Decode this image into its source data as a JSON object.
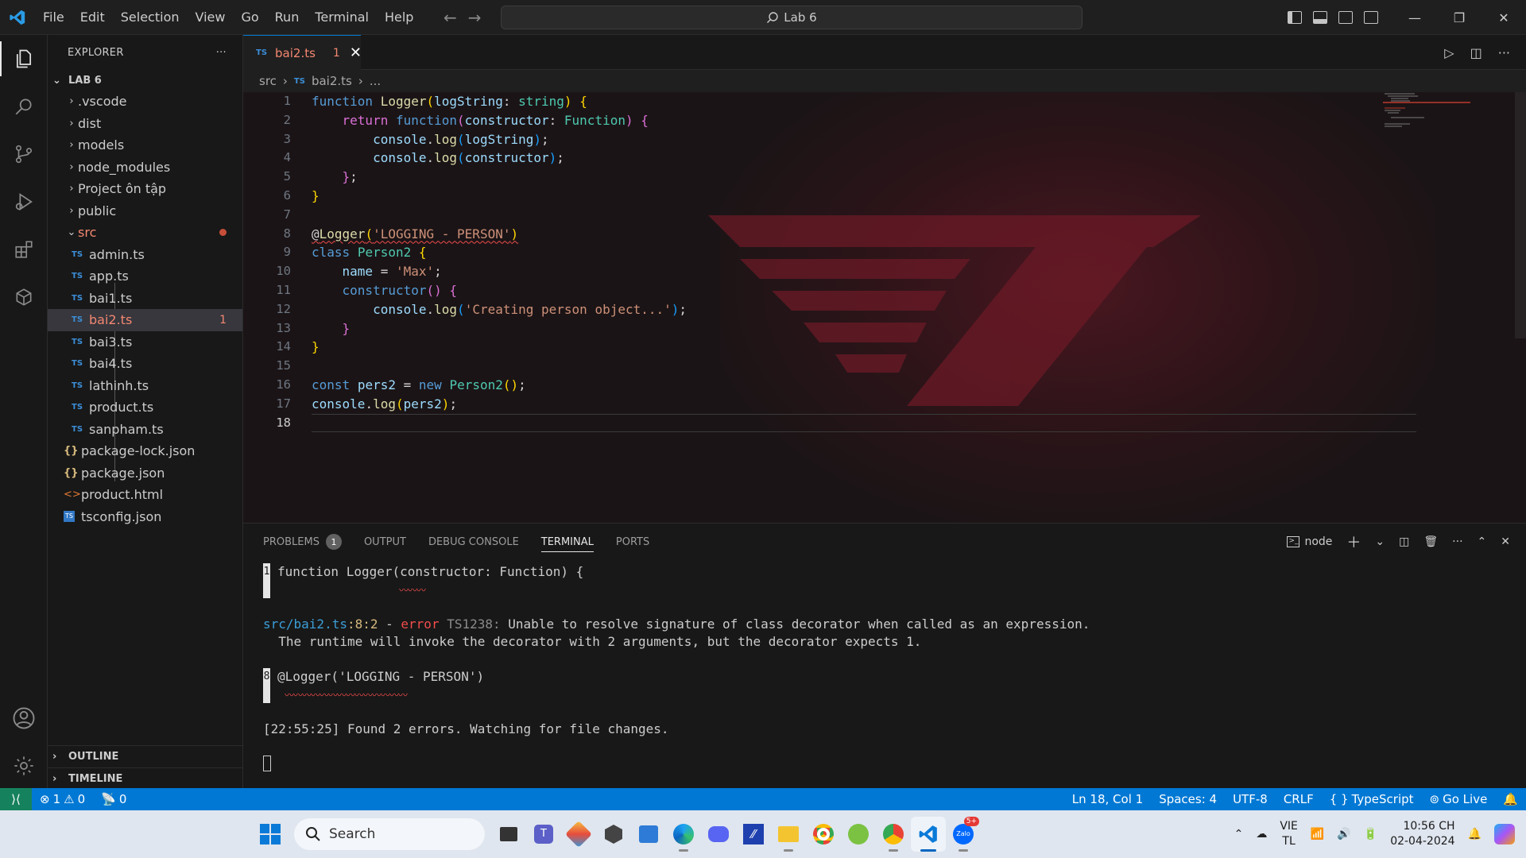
{
  "titlebar": {
    "menu": [
      "File",
      "Edit",
      "Selection",
      "View",
      "Go",
      "Run",
      "Terminal",
      "Help"
    ],
    "search": "Lab 6"
  },
  "explorer": {
    "title": "EXPLORER",
    "folder": "LAB 6",
    "items": [
      {
        "label": ".vscode",
        "type": "folder"
      },
      {
        "label": "dist",
        "type": "folder"
      },
      {
        "label": "models",
        "type": "folder"
      },
      {
        "label": "node_modules",
        "type": "folder"
      },
      {
        "label": "Project ôn tập",
        "type": "folder"
      },
      {
        "label": "public",
        "type": "folder"
      },
      {
        "label": "src",
        "type": "folder-open"
      },
      {
        "label": "admin.ts",
        "type": "ts"
      },
      {
        "label": "app.ts",
        "type": "ts"
      },
      {
        "label": "bai1.ts",
        "type": "ts"
      },
      {
        "label": "bai2.ts",
        "type": "ts",
        "badge": "1"
      },
      {
        "label": "bai3.ts",
        "type": "ts"
      },
      {
        "label": "bai4.ts",
        "type": "ts"
      },
      {
        "label": "lathinh.ts",
        "type": "ts"
      },
      {
        "label": "product.ts",
        "type": "ts"
      },
      {
        "label": "sanpham.ts",
        "type": "ts"
      },
      {
        "label": "package-lock.json",
        "type": "json"
      },
      {
        "label": "package.json",
        "type": "json"
      },
      {
        "label": "product.html",
        "type": "html"
      },
      {
        "label": "tsconfig.json",
        "type": "tsconfig"
      }
    ],
    "outline": "OUTLINE",
    "timeline": "TIMELINE"
  },
  "tab": {
    "label": "bai2.ts",
    "problems": "1",
    "icon": "TS"
  },
  "breadcrumb": {
    "folder": "src",
    "file": "bai2.ts",
    "more": "..."
  },
  "editor": {
    "lines": [
      "1",
      "2",
      "3",
      "4",
      "5",
      "6",
      "7",
      "8",
      "9",
      "10",
      "11",
      "12",
      "13",
      "14",
      "15",
      "16",
      "17",
      "18"
    ],
    "current_line": "18"
  },
  "panel": {
    "tabs": [
      "PROBLEMS",
      "OUTPUT",
      "DEBUG CONSOLE",
      "TERMINAL",
      "PORTS"
    ],
    "problems_count": "1",
    "active": "TERMINAL",
    "shell": "node",
    "terminal": {
      "l1_num": "1",
      "l1_code": "function Logger(constructor: Function) {",
      "err_path": "src/bai2.ts",
      "err_loc": ":8:2",
      "err_sep": " - ",
      "err_word": "error",
      "err_code": " TS1238:",
      "err_msg": " Unable to resolve signature of class decorator when called as an expression.",
      "err_msg2": "  The runtime will invoke the decorator with 2 arguments, but the decorator expects 1.",
      "l8_num": "8",
      "l8_code": "@Logger('LOGGING - PERSON')",
      "found_time": "[22:55:25]",
      "found_msg": " Found 2 errors. Watching for file changes."
    }
  },
  "statusbar": {
    "errors": "1",
    "warnings": "0",
    "ports": "0",
    "position": "Ln 18, Col 1",
    "spaces": "Spaces: 4",
    "encoding": "UTF-8",
    "eol": "CRLF",
    "language": "TypeScript",
    "golive": "Go Live"
  },
  "taskbar": {
    "search": "Search",
    "lang": "VIE",
    "lang2": "TL",
    "time": "10:56 CH",
    "date": "02-04-2024",
    "zalo_badge": "5+"
  },
  "colors": {
    "accent": "#0078d4",
    "statusbar": "#0078d4",
    "error": "#f14c4c"
  }
}
